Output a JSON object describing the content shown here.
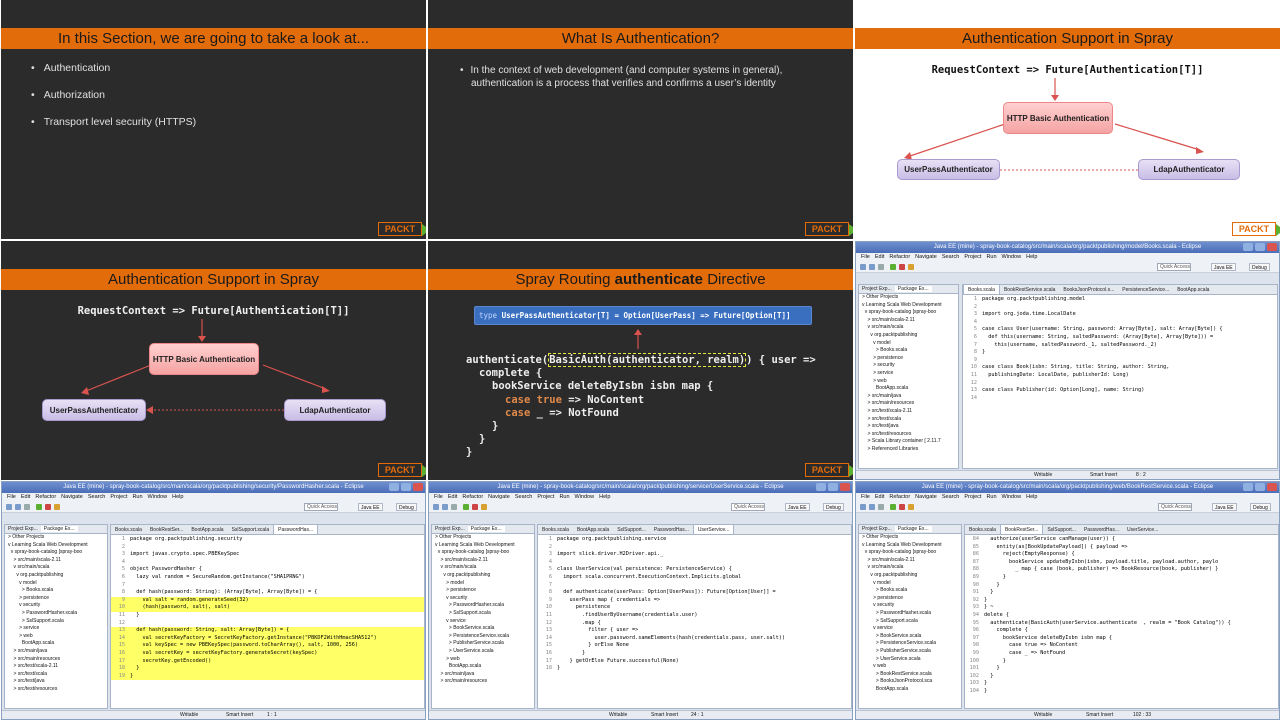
{
  "slide1": {
    "title": "In this Section, we are going to take a look at...",
    "bullets": [
      "Authentication",
      "Authorization",
      "Transport level security (HTTPS)"
    ],
    "logo": "PACKT"
  },
  "slide2": {
    "title": "What Is Authentication?",
    "bullet_line1": "In the context of web development (and computer systems in general),",
    "bullet_line2": "authentication is a process that verifies and confirms a user’s identity",
    "logo": "PACKT"
  },
  "slide3": {
    "title": "Authentication Support in Spray",
    "signature": "RequestContext => Future[Authentication[T]]",
    "node_basic": "HTTP Basic Authentication",
    "node_userpass": "UserPassAuthenticator",
    "node_ldap": "LdapAuthenticator",
    "logo": "PACKT"
  },
  "slide4": {
    "title": "Authentication Support in Spray",
    "signature": "RequestContext => Future[Authentication[T]]",
    "node_basic": "HTTP Basic Authentication",
    "node_userpass": "UserPassAuthenticator",
    "node_ldap": "LdapAuthenticator",
    "logo": "PACKT"
  },
  "slide5": {
    "title_pre": "Spray Routing ",
    "title_bold": "authenticate",
    "title_post": " Directive",
    "type_kw": "type",
    "type_rest": " UserPassAuthenticator[T] = Option[UserPass] => Future[Option[T]]",
    "code_l1_pre": "authenticate(",
    "code_l1_box": "BasicAuth(authenticator, realm)",
    "code_l1_post": ") { user =>",
    "code_l2": "complete {",
    "code_l3": "bookService deleteByIsbn isbn map {",
    "code_l4_case": "case",
    "code_l4_true": "true",
    "code_l4_rest": " => NoContent",
    "code_l5_case": "case",
    "code_l5_rest": " _ => NotFound",
    "code_l6": "}",
    "code_l7": "}",
    "code_l8": "}",
    "logo": "PACKT"
  },
  "menu": [
    "File",
    "Edit",
    "Refactor",
    "Navigate",
    "Search",
    "Project",
    "Run",
    "Window",
    "Help"
  ],
  "quick_access": "Quick Access",
  "persp_javaee": "Java EE",
  "persp_debug": "Debug",
  "status_writable": "Writable",
  "status_insert": "Smart Insert",
  "pkg_tab1": "Project Exp...",
  "pkg_tab2": "Package Ex...",
  "ide1": {
    "title": "Java EE (mine) - spray-book-catalog/src/main/scala/org/packtpublishing/model/Books.scala - Eclipse",
    "tabs": [
      "Books.scala",
      "BookRestService.scala",
      "BooksJsonProtocol.s...",
      "PersistenceService...",
      "BootApp.scala"
    ],
    "tree": [
      "> Other Projects",
      "v Learning Scala Web Development",
      "  v spray-book-catalog [spray-boo",
      "    > src/main/scala-2.11",
      "    v src/main/scala",
      "      v org.packtpublishing",
      "        v model",
      "          > Books.scala",
      "        > persistence",
      "        > security",
      "        > service",
      "        > web",
      "          BootApp.scala",
      "    > src/main/java",
      "    > src/main/resources",
      "    > src/test/scala-2.11",
      "    > src/test/scala",
      "    > src/test/java",
      "    > src/test/resources",
      "    > Scala Library container [ 2.11.7",
      "    > Referenced Libraries"
    ],
    "code": [
      "package org.packtpublishing.model",
      "",
      "import org.joda.time.LocalDate",
      "",
      "case class User(username: String, password: Array[Byte], salt: Array[Byte]) {",
      "  def this(username: String, saltedPassword: (Array[Byte], Array[Byte])) =",
      "    this(username, saltedPassword._1, saltedPassword._2)",
      "}",
      "",
      "case class Book(isbn: String, title: String, author: String,",
      "  publishingDate: LocalDate, publisherId: Long)",
      "",
      "case class Publisher(id: Option[Long], name: String)",
      ""
    ],
    "position": "8 : 2"
  },
  "ide2": {
    "title": "Java EE (mine) - spray-book-catalog/src/main/scala/org/packtpublishing/security/PasswordHasher.scala - Eclipse",
    "tabs": [
      "Books.scala",
      "BookRestSer...",
      "BootApp.scala",
      "SslSupport.scala",
      "PasswordHas..."
    ],
    "tree": [
      "> Other Projects",
      "v Learning Scala Web Development",
      "  v spray-book-catalog [spray-boo",
      "    > src/main/scala-2.11",
      "    v src/main/scala",
      "      v org.packtpublishing",
      "        v model",
      "          > Books.scala",
      "        > persistence",
      "        v security",
      "          > PasswordHasher.scala",
      "          > SslSupport.scala",
      "        > service",
      "        > web",
      "          BootApp.scala",
      "    > src/main/java",
      "    > src/main/resources",
      "    > src/test/scala-2.11",
      "    > src/test/scala",
      "    > src/test/java",
      "    > src/test/resources"
    ],
    "code": [
      "package org.packtpublishing.security",
      "",
      "import javax.crypto.spec.PBEKeySpec",
      "",
      "object PasswordHasher {",
      "  lazy val random = SecureRandom.getInstance(\"SHA1PRNG\")",
      "",
      "  def hash(password: String): (Array[Byte], Array[Byte]) = {",
      "    val salt = random.generateSeed(32)",
      "    (hash(password, salt), salt)",
      "  }",
      "",
      "  def hash(password: String, salt: Array[Byte]) = {",
      "    val secretKeyFactory = SecretKeyFactory.getInstance(\"PBKDF2WithHmacSHA512\")",
      "    val keySpec = new PBEKeySpec(password.toCharArray(), salt, 1000, 256)",
      "    val secretKey = secretKeyFactory.generateSecret(keySpec)",
      "    secretKey.getEncoded()",
      "  }",
      "}"
    ],
    "position": "1 : 1"
  },
  "ide3": {
    "title": "Java EE (mine) - spray-book-catalog/src/main/scala/org/packtpublishing/service/UserService.scala - Eclipse",
    "tabs": [
      "Books.scala",
      "BootApp.scala",
      "SslSupport...",
      "PasswordHas...",
      "UserService..."
    ],
    "tree": [
      "> Other Projects",
      "v Learning Scala Web Development",
      "  v spray-book-catalog [spray-boo",
      "    > src/main/scala-2.11",
      "    v src/main/scala",
      "      v org.packtpublishing",
      "        > model",
      "        > persistence",
      "        v security",
      "          > PasswordHasher.scala",
      "          > SslSupport.scala",
      "        v service",
      "          > BookService.scala",
      "          > PersistenceService.scala",
      "          > PublisherService.scala",
      "          > UserService.scala",
      "        > web",
      "          BootApp.scala",
      "    > src/main/java",
      "    > src/main/resources"
    ],
    "code": [
      "package org.packtpublishing.service",
      "",
      "import slick.driver.H2Driver.api._",
      "",
      "class UserService(val persistence: PersistenceService) {",
      "  import scala.concurrent.ExecutionContext.Implicits.global",
      "",
      "  def authenticate(userPass: Option[UserPass]): Future[Option[User]] =",
      "    userPass map { credentials =>",
      "      persistence",
      "        .findUserByUsername(credentials.user)",
      "        .map {",
      "          filter { user =>",
      "            user.password.sameElements(hash(credentials.pass, user.salt))",
      "          } orElse None",
      "        }",
      "    } getOrElse Future.successful(None)",
      "}"
    ],
    "position": "24 : 1"
  },
  "ide4": {
    "title": "Java EE (mine) - spray-book-catalog/src/main/scala/org/packtpublishing/web/BookRestService.scala - Eclipse",
    "tabs": [
      "Books.scala",
      "BookRestSer...",
      "SslSupport...",
      "PasswordHas...",
      "UserService..."
    ],
    "tree": [
      "> Other Projects",
      "v Learning Scala Web Development",
      "  v spray-book-catalog [spray-boo",
      "    > src/main/scala-2.11",
      "    v src/main/scala",
      "      v org.packtpublishing",
      "        v model",
      "          > Books.scala",
      "        > persistence",
      "        v security",
      "          > PasswordHasher.scala",
      "          > SslSupport.scala",
      "        v service",
      "          > BookService.scala",
      "          > PersistenceService.scala",
      "          > PublisherService.scala",
      "          > UserService.scala",
      "        v web",
      "          > BookRestService.scala",
      "          > BooksJsonProtocol.sca",
      "          BootApp.scala"
    ],
    "code": [
      "  authorize(userService canManage(user)) {",
      "    entity(as[BookUpdatePayload]) { payload =>",
      "      reject(EmptyResponse) {",
      "        bookService updateByIsbn(isbn, payload.title, payload.author, paylo",
      "          _ map { case (book, publisher) => BookResource(book, publisher) }",
      "      }",
      "    }",
      "  }",
      "}",
      "} ~",
      "delete {",
      "  authenticate(BasicAuth(userService.authenticate  , realm = \"Book Catalog\")) {",
      "    complete {",
      "      bookService deleteByIsbn isbn map {",
      "        case true => NoContent",
      "        case _ => NotFound",
      "      }",
      "    }",
      "  }",
      "}",
      "}"
    ],
    "position": "102 : 33"
  }
}
